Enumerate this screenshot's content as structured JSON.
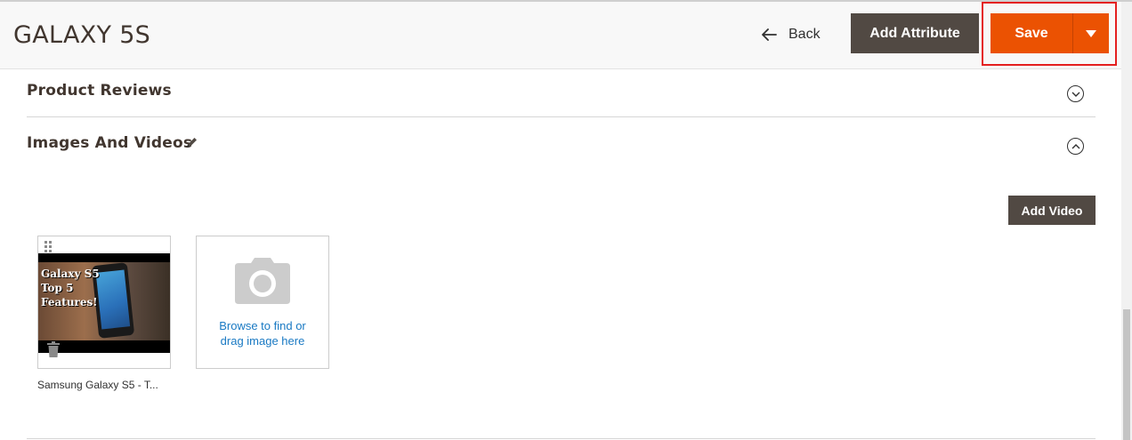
{
  "header": {
    "title": "GALAXY 5S",
    "back_label": "Back",
    "add_attribute_label": "Add Attribute",
    "save_label": "Save"
  },
  "sections": {
    "product_reviews": {
      "title": "Product Reviews"
    },
    "images_and_videos": {
      "title": "Images And Videos"
    }
  },
  "media": {
    "add_video_label": "Add Video",
    "items": [
      {
        "caption": "Samsung Galaxy S5 - T...",
        "overlay_text": [
          "Galaxy S5",
          "Top 5",
          "Features!"
        ]
      }
    ],
    "upload": {
      "line1": "Browse to find or",
      "line2": "drag image here"
    }
  },
  "icons": {
    "back": "arrow-left-icon",
    "save_toggle": "triangle-down-icon",
    "section_collapsed": "chevron-down-circle-icon",
    "section_expanded": "chevron-up-circle-icon",
    "edit": "pencil-icon",
    "drag": "drag-handle-icon",
    "delete": "trash-icon",
    "upload": "camera-icon"
  },
  "colors": {
    "accent": "#eb5202",
    "dark_button": "#514943",
    "link": "#1979c3",
    "highlight": "#e41f1f"
  }
}
